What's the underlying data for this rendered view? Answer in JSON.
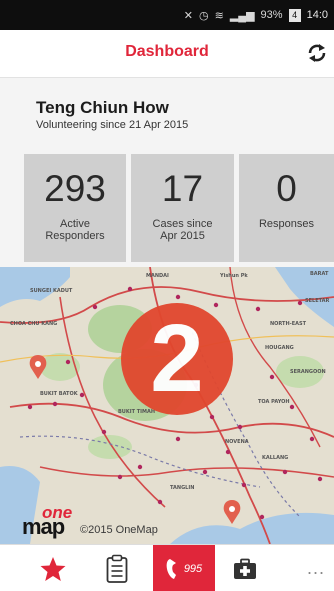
{
  "status_bar": {
    "icons": [
      "mute-icon",
      "alarm-icon",
      "wifi-icon",
      "signal-icon"
    ],
    "battery": "93%",
    "battery_badge": "4",
    "time": "14:0"
  },
  "header": {
    "title": "Dashboard",
    "sync_icon": "sync-icon"
  },
  "profile": {
    "name": "Teng Chiun How",
    "subtitle": "Volunteering since 21 Apr 2015"
  },
  "stats": [
    {
      "value": "293",
      "label_line1": "Active",
      "label_line2": "Responders"
    },
    {
      "value": "17",
      "label_line1": "Cases since",
      "label_line2": "Apr 2015"
    },
    {
      "value": "0",
      "label_line1": "Responses",
      "label_line2": ""
    }
  ],
  "map": {
    "badge_number": "2",
    "logo_one": "one",
    "logo_map": "map",
    "copyright": "©2015 OneMap",
    "place_labels": [
      "SUNGEI KADUT",
      "MANDAI",
      "Yishun Pk",
      "NORTH-EAST",
      "SELETAR",
      "CHOA CHU KANG",
      "HOUGANG",
      "SERANGOON",
      "BUKIT BATOK",
      "BUKIT TIMAH",
      "TOA PAYOH",
      "NOVENA",
      "TANGLIN",
      "KALLANG",
      "BARAT"
    ],
    "colors": {
      "land": "#e4dfd0",
      "water": "#a9c9e6",
      "green": "#b5d39e",
      "road": "#d24a4a",
      "badge": "#e1472e"
    }
  },
  "bottom_nav": {
    "items": [
      "star-icon",
      "clipboard-icon",
      "phone-995-icon",
      "medkit-icon",
      "more-icon"
    ],
    "call_label": "995",
    "more_label": "..."
  },
  "colors": {
    "accent": "#e0263a",
    "card_bg": "#cfcfcf"
  }
}
